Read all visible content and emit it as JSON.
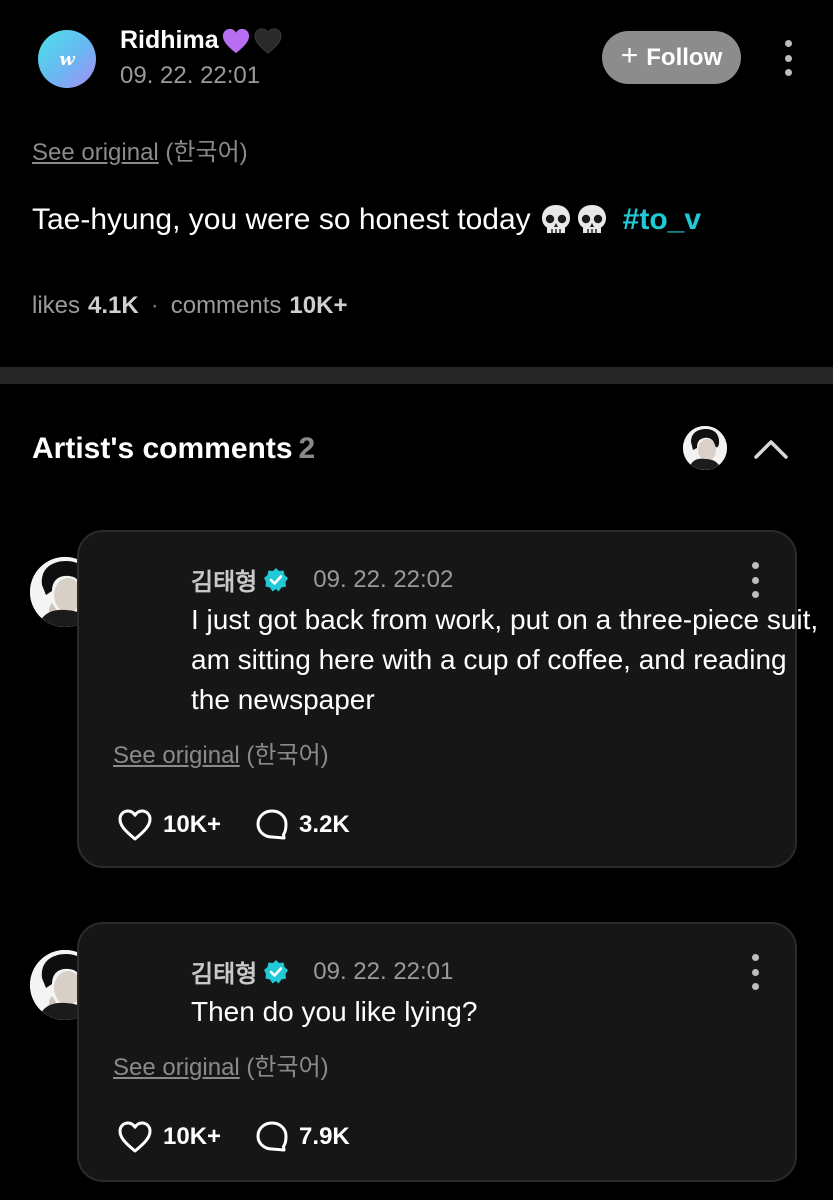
{
  "post": {
    "author": "Ridhima",
    "avatar_letter": "w",
    "timestamp": "09. 22. 22:01",
    "follow_label": "Follow",
    "see_original": "See original",
    "language": "(한국어)",
    "body": "Tae-hyung, you were so honest today",
    "hashtag": "#to_v",
    "likes_label": "likes",
    "likes_count": "4.1K",
    "comments_label": "comments",
    "comments_count": "10K+"
  },
  "artist_section": {
    "title": "Artist's comments",
    "count": "2"
  },
  "comments": [
    {
      "author": "김태형",
      "timestamp": "09. 22. 22:02",
      "text": "I just got back from work, put on a three-piece suit, am sitting here with a cup of coffee, and reading the newspaper",
      "see_original": "See original",
      "language": "(한국어)",
      "likes": "10K+",
      "replies": "3.2K"
    },
    {
      "author": "김태형",
      "timestamp": "09. 22. 22:01",
      "text": "Then do you like lying?",
      "see_original": "See original",
      "language": "(한국어)",
      "likes": "10K+",
      "replies": "7.9K"
    }
  ],
  "colors": {
    "background": "#000000",
    "card": "#161616",
    "hashtag": "#21c9d6",
    "verified": "#21c9d6",
    "follow_button": "#8c8c8c",
    "divider": "#262626"
  },
  "icons": [
    "w-logo-avatar",
    "purple-heart-emoji",
    "black-heart-emoji",
    "plus-icon",
    "kebab-menu-icon",
    "skull-emoji",
    "chevron-up-icon",
    "verified-badge-icon",
    "heart-icon",
    "comment-bubble-icon"
  ]
}
